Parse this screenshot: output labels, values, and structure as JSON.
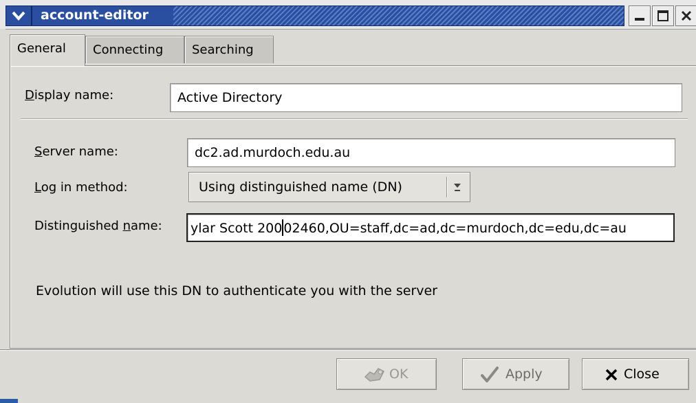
{
  "window": {
    "title": "account-editor",
    "menu_icon": "chevron-down-icon",
    "minimize_icon": "minimize-icon",
    "maximize_icon": "maximize-icon",
    "close_icon": "close-icon"
  },
  "tabs": [
    {
      "label": "General",
      "active": true
    },
    {
      "label": "Connecting",
      "active": false
    },
    {
      "label": "Searching",
      "active": false
    }
  ],
  "general": {
    "display_name_label_mnemonic": "D",
    "display_name_label_rest": "isplay name:",
    "display_name_value": "Active Directory",
    "server_name_label_mnemonic": "S",
    "server_name_label_rest": "erver name:",
    "server_name_value": "dc2.ad.murdoch.edu.au",
    "login_method_label_mnemonic": "L",
    "login_method_label_rest": "og in method:",
    "login_method_value": "Using distinguished name (DN)",
    "dn_label_prefix": "Distinguished ",
    "dn_label_mnemonic": "n",
    "dn_label_rest": "ame:",
    "dn_value_before_cursor": "ylar Scott 200",
    "dn_value_after_cursor": "02460,OU=staff,dc=ad,dc=murdoch,dc=edu,dc=au",
    "help_text": "Evolution will use this DN to authenticate you with the server"
  },
  "buttons": {
    "ok_label": "OK",
    "ok_icon": "ok-icon",
    "apply_label": "Apply",
    "apply_icon": "checkmark-icon",
    "close_label": "Close",
    "close_icon": "x-icon"
  }
}
